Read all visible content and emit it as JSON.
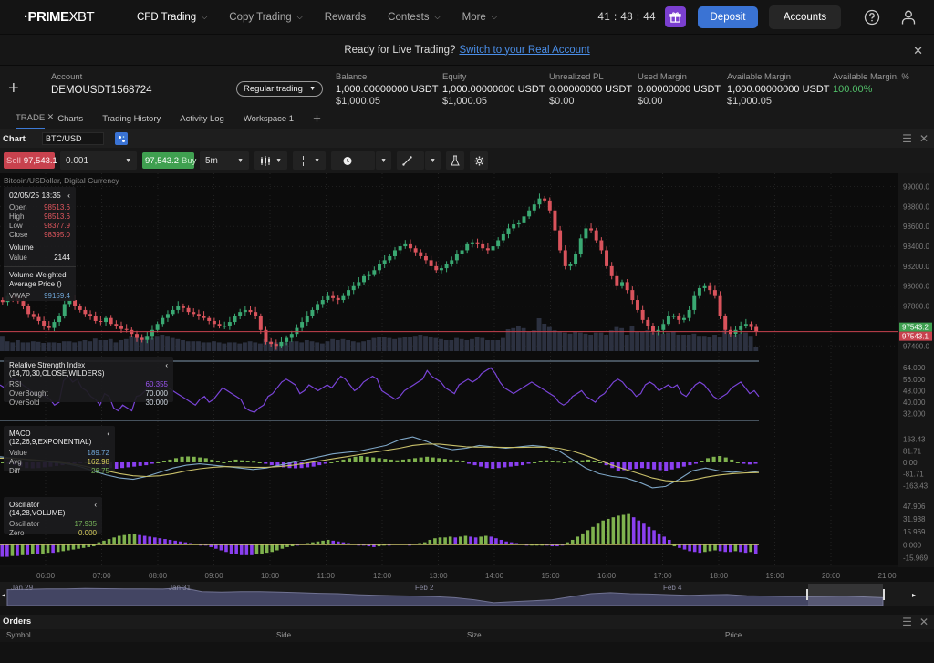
{
  "brand": {
    "name_bold": "·PRIME",
    "name_light": "XBT"
  },
  "topnav": {
    "items": [
      {
        "label": "CFD Trading",
        "has_dropdown": true,
        "active": true
      },
      {
        "label": "Copy Trading",
        "has_dropdown": true,
        "active": false
      },
      {
        "label": "Rewards",
        "has_dropdown": false,
        "active": false
      },
      {
        "label": "Contests",
        "has_dropdown": true,
        "active": false
      },
      {
        "label": "More",
        "has_dropdown": true,
        "active": false
      }
    ],
    "timer": "41 : 48 : 44",
    "gift_icon": "gift-icon",
    "deposit_label": "Deposit",
    "accounts_label": "Accounts",
    "help_icon": "help-circle-icon",
    "user_icon": "user-icon",
    "colors": {
      "deposit": "#3a73d4",
      "gift": "#7b3fd0"
    }
  },
  "banner": {
    "text": "Ready for Live Trading?",
    "link": "Switch to your Real Account",
    "close_icon": "close-icon"
  },
  "account": {
    "add_icon": "plus-icon",
    "account_label": "Account",
    "account_id": "DEMOUSDT1568724",
    "mode": "Regular trading",
    "fields": [
      {
        "label": "Balance",
        "value": "1,000.00000000 USDT",
        "usd": "$1,000.05"
      },
      {
        "label": "Equity",
        "value": "1,000.00000000 USDT",
        "usd": "$1,000.05"
      },
      {
        "label": "Unrealized PL",
        "value": "0.00000000 USDT",
        "usd": "$0.00"
      },
      {
        "label": "Used Margin",
        "value": "0.00000000 USDT",
        "usd": "$0.00"
      },
      {
        "label": "Available Margin",
        "value": "1,000.00000000 USDT",
        "usd": "$1,000.05"
      },
      {
        "label": "Available Margin, %",
        "value": "100.00%",
        "usd": ""
      }
    ]
  },
  "tabs": [
    {
      "label": "TRADE",
      "active": true,
      "closable": true
    },
    {
      "label": "Charts",
      "active": false
    },
    {
      "label": "Trading History",
      "active": false
    },
    {
      "label": "Activity Log",
      "active": false
    },
    {
      "label": "Workspace 1",
      "active": false
    }
  ],
  "chart_panel": {
    "title": "Chart",
    "symbol": "BTC/USD",
    "subtitle": "Bitcoin/USDollar, Digital Currency",
    "toolbar": {
      "sell_label": "Sell",
      "sell_price": "97,543.1",
      "quantity": "0.001",
      "buy_price": "97,543.2",
      "buy_label": "Buy",
      "interval": "5m",
      "chart_type_icon": "candlestick-icon",
      "crosshair_icon": "crosshair-icon",
      "timeline_icon": "clock-icon",
      "draw_icon": "line-draw-icon",
      "studies_icon": "flask-icon",
      "settings_icon": "gear-icon"
    },
    "ohlc_box": {
      "datetime": "02/05/25 13:35",
      "open_label": "Open",
      "open": "98513.6",
      "high_label": "High",
      "high": "98513.6",
      "low_label": "Low",
      "low": "98377.9",
      "close_label": "Close",
      "close": "98395.0",
      "volume_title": "Volume",
      "volume_label": "Value",
      "volume": "2144",
      "vwap_title": "Volume Weighted Average Price ()",
      "vwap_label": "VWAP",
      "vwap": "99159.4"
    },
    "rsi_box": {
      "title": "Relative Strength Index (14,70,30,CLOSE,WILDERS)",
      "rsi_label": "RSI",
      "rsi": "60.355",
      "ob_label": "OverBought",
      "ob": "70.000",
      "os_label": "OverSold",
      "os": "30.000"
    },
    "macd_box": {
      "title": "MACD (12,26,9,EXPONENTIAL)",
      "value_label": "Value",
      "value": "189.72",
      "avg_label": "Avg",
      "avg": "162.98",
      "diff_label": "Diff",
      "diff": "26.75"
    },
    "osc_box": {
      "title": "Oscillator (14,28,VOLUME)",
      "osc_label": "Oscillator",
      "osc": "17.935",
      "zero_label": "Zero",
      "zero": "0.000"
    }
  },
  "chart_data": {
    "type": "candlestick",
    "title": "BTC/USD",
    "interval": "5m",
    "price_axis": {
      "ticks": [
        "99000.0",
        "98800.0",
        "98600.0",
        "98400.0",
        "98200.0",
        "98000.0",
        "97800.0",
        "97400.0"
      ],
      "range": [
        97320,
        99060
      ]
    },
    "last_price": {
      "bid": "97543.1",
      "ask": "97543.2",
      "colors": {
        "bid": "#c8424e",
        "ask": "#3fa050"
      }
    },
    "time_axis": [
      "06:00",
      "07:00",
      "08:00",
      "09:00",
      "10:00",
      "11:00",
      "12:00",
      "13:00",
      "14:00",
      "15:00",
      "16:00",
      "17:00",
      "18:00",
      "19:00",
      "20:00",
      "21:00"
    ],
    "close_series": [
      97840,
      97900,
      97880,
      97850,
      97800,
      97720,
      97690,
      97650,
      97600,
      97580,
      97640,
      97700,
      97820,
      97860,
      97800,
      97760,
      97720,
      97700,
      97650,
      97640,
      97680,
      97620,
      97600,
      97570,
      97560,
      97520,
      97480,
      97460,
      97500,
      97560,
      97620,
      97680,
      97720,
      97760,
      97800,
      97780,
      97740,
      97720,
      97700,
      97680,
      97650,
      97620,
      97600,
      97600,
      97640,
      97700,
      97740,
      97760,
      97740,
      97700,
      97560,
      97440,
      97420,
      97400,
      97440,
      97480,
      97520,
      97580,
      97640,
      97700,
      97760,
      97820,
      97860,
      97900,
      97880,
      97860,
      97900,
      97960,
      98000,
      98040,
      98100,
      98120,
      98160,
      98220,
      98260,
      98300,
      98360,
      98400,
      98420,
      98380,
      98340,
      98300,
      98260,
      98200,
      98160,
      98180,
      98220,
      98260,
      98320,
      98360,
      98420,
      98440,
      98420,
      98380,
      98360,
      98400,
      98460,
      98520,
      98580,
      98620,
      98640,
      98700,
      98760,
      98820,
      98880,
      98860,
      98760,
      98560,
      98360,
      98200,
      98220,
      98320,
      98480,
      98580,
      98560,
      98460,
      98360,
      98200,
      98100,
      98000,
      98040,
      97960,
      97860,
      97760,
      97660,
      97600,
      97540,
      97560,
      97620,
      97700,
      97700,
      97660,
      97680,
      97760,
      97900,
      97980,
      98000,
      97960,
      97900,
      97700,
      97560,
      97520,
      97560,
      97600,
      97620,
      97590,
      97543
    ],
    "volume_relative": [
      0.28,
      0.18,
      0.16,
      0.2,
      0.16,
      0.16,
      0.18,
      0.17,
      0.15,
      0.16,
      0.16,
      0.15,
      0.18,
      0.18,
      0.16,
      0.18,
      0.2,
      0.18,
      0.23,
      0.2,
      0.2,
      0.22,
      0.16,
      0.2,
      0.22,
      0.28,
      0.26,
      0.26,
      0.28,
      0.24,
      0.28,
      0.3,
      0.28,
      0.24,
      0.22,
      0.2,
      0.18,
      0.18,
      0.18,
      0.16,
      0.16,
      0.18,
      0.16,
      0.14,
      0.16,
      0.16,
      0.14,
      0.16,
      0.18,
      0.16,
      0.14,
      0.22,
      0.18,
      0.16,
      0.16,
      0.16,
      0.18,
      0.18,
      0.16,
      0.2,
      0.18,
      0.16,
      0.14,
      0.18,
      0.22,
      0.2,
      0.22,
      0.2,
      0.18,
      0.16,
      0.18,
      0.2,
      0.24,
      0.26,
      0.26,
      0.24,
      0.22,
      0.24,
      0.26,
      0.26,
      0.28,
      0.3,
      0.28,
      0.26,
      0.24,
      0.22,
      0.2,
      0.2,
      0.24,
      0.22,
      0.2,
      0.22,
      0.26,
      0.24,
      0.2,
      0.2,
      0.2,
      0.24,
      0.4,
      0.42,
      0.46,
      0.42,
      0.36,
      0.38,
      0.6,
      0.5,
      0.44,
      0.38,
      0.36,
      0.34,
      0.32,
      0.36,
      0.34,
      0.32,
      0.3,
      0.34,
      0.34,
      0.3,
      0.38,
      0.44,
      0.42,
      0.3,
      0.46,
      0.36,
      0.36,
      0.38,
      0.34,
      0.34,
      0.32,
      0.34,
      0.36,
      0.3,
      0.3,
      0.3,
      0.32,
      0.28,
      0.28,
      0.26,
      0.3,
      0.26,
      0.38,
      0.32,
      0.3,
      0.32,
      0.34,
      0.28,
      0.08
    ],
    "rsi": {
      "range": [
        28,
        66
      ],
      "ticks": [
        "64.000",
        "56.000",
        "48.000",
        "40.000",
        "32.000"
      ],
      "overbought": 70,
      "oversold": 30,
      "values": [
        52,
        50,
        54,
        56,
        55,
        52,
        50,
        47,
        45,
        46,
        44,
        42,
        38,
        40,
        55,
        58,
        54,
        56,
        50,
        48,
        44,
        42,
        38,
        46,
        44,
        36,
        34,
        38,
        36,
        34,
        44,
        45,
        48,
        52,
        54,
        50,
        52,
        50,
        48,
        46,
        44,
        42,
        40,
        38,
        42,
        44,
        40,
        42,
        46,
        50,
        48,
        46,
        44,
        42,
        36,
        34,
        33,
        36,
        38,
        44,
        46,
        50,
        54,
        56,
        54,
        52,
        46,
        48,
        52,
        50,
        48,
        50,
        52,
        50,
        54,
        58,
        56,
        52,
        48,
        50,
        54,
        56,
        58,
        56,
        48,
        46,
        44,
        42,
        44,
        48,
        50,
        52,
        54,
        56,
        62,
        58,
        56,
        54,
        50,
        48,
        46,
        52,
        54,
        56,
        54,
        56,
        60,
        62,
        64,
        60,
        54,
        50,
        48,
        46,
        48,
        50,
        52,
        54,
        52,
        50,
        48,
        46,
        44,
        40,
        38,
        40,
        44,
        46,
        48,
        44,
        42,
        40,
        44,
        46,
        50,
        54,
        56,
        54,
        50,
        48,
        44,
        46,
        52,
        54,
        52,
        48,
        50,
        52,
        50,
        52,
        46,
        44,
        48,
        52,
        54,
        52,
        48,
        44,
        42,
        44,
        46,
        50,
        52,
        54,
        50,
        46,
        48,
        44
      ]
    },
    "macd": {
      "range": [
        -200,
        200
      ],
      "ticks": [
        "163.43",
        "81.71",
        "0.00",
        "-81.71",
        "-163.43"
      ],
      "histogram": [
        0,
        -10,
        -20,
        -30,
        -40,
        -42,
        -40,
        -35,
        -30,
        -25,
        -20,
        -15,
        -10,
        -5,
        0,
        -10,
        -20,
        -30,
        -40,
        -45,
        -40,
        -35,
        -30,
        -25,
        -20,
        -10,
        0,
        10,
        20,
        30,
        40,
        42,
        40,
        35,
        30,
        20,
        10,
        0,
        10,
        20,
        15,
        10,
        5,
        0,
        -10,
        -20,
        -30,
        -35,
        -40,
        -42,
        -40,
        -35,
        -30,
        -20,
        -10,
        0,
        10,
        20,
        30,
        40,
        45,
        40,
        35,
        30,
        25,
        20,
        15,
        20,
        25,
        30,
        35,
        40,
        35,
        30,
        25,
        20,
        15,
        10,
        -10,
        -20,
        -30,
        -40,
        -45,
        -40,
        -35,
        -30,
        -25,
        -20,
        -10,
        0,
        10,
        15,
        10,
        5,
        0,
        5,
        10,
        15,
        20,
        10,
        0,
        -20,
        -40,
        -60,
        -55,
        -50,
        -45,
        -40,
        -45,
        -50,
        -55,
        -60,
        -50,
        -40,
        -30,
        -20,
        -10,
        10,
        30,
        40,
        45,
        35,
        20,
        0,
        -10,
        -15,
        -10
      ],
      "value": [
        40,
        30,
        20,
        10,
        0,
        -10,
        -30,
        -60,
        -90,
        -110,
        -120,
        -100,
        -70,
        -40,
        -20,
        -10,
        -20,
        -30,
        -40,
        -50,
        -40,
        -20,
        0,
        20,
        40,
        60,
        70,
        80,
        100,
        120,
        160,
        180,
        150,
        110,
        90,
        100,
        120,
        110,
        100,
        110,
        120,
        110,
        80,
        20,
        -40,
        -80,
        -100,
        -110,
        -140,
        -180,
        -170,
        -120,
        -60,
        -40,
        -60,
        -70,
        -60,
        -70
      ],
      "signal": [
        30,
        28,
        22,
        15,
        5,
        -5,
        -20,
        -40,
        -60,
        -80,
        -95,
        -100,
        -95,
        -80,
        -60,
        -45,
        -35,
        -30,
        -32,
        -35,
        -35,
        -30,
        -20,
        -5,
        10,
        25,
        40,
        55,
        70,
        85,
        100,
        120,
        130,
        130,
        120,
        110,
        108,
        108,
        106,
        106,
        108,
        108,
        100,
        80,
        50,
        15,
        -20,
        -50,
        -80,
        -110,
        -130,
        -135,
        -125,
        -105,
        -90,
        -80,
        -75,
        -72
      ]
    },
    "oscillator": {
      "range": [
        -20,
        50
      ],
      "ticks": [
        "47.906",
        "31.938",
        "15.969",
        "0.000",
        "-15.969"
      ],
      "values": [
        -15,
        -15,
        -14,
        -14,
        -13,
        -13,
        -12,
        -12,
        -11,
        -10,
        -10,
        -9,
        -8,
        -7,
        -6,
        -5,
        -4,
        -3,
        -2,
        3,
        5,
        7,
        9,
        11,
        12,
        13,
        13,
        12,
        11,
        10,
        9,
        8,
        7,
        6,
        5,
        4,
        3,
        2,
        1,
        0,
        -1,
        -3,
        -5,
        -7,
        -9,
        -11,
        -12,
        -13,
        -13,
        -13,
        -12,
        -11,
        -10,
        -9,
        -7,
        -5,
        -3,
        -2,
        0,
        1,
        2,
        3,
        4,
        5,
        6,
        5,
        4,
        3,
        2,
        1,
        0,
        -1,
        -2,
        -3,
        -2,
        -1,
        0,
        1,
        1,
        1,
        0,
        1,
        2,
        3,
        6,
        8,
        9,
        9,
        10,
        9,
        10,
        11,
        10,
        9,
        10,
        11,
        10,
        8,
        6,
        4,
        3,
        2,
        1,
        0,
        0,
        0,
        0,
        -1,
        -2,
        -2,
        0,
        3,
        6,
        10,
        14,
        18,
        22,
        26,
        30,
        32,
        34,
        36,
        37,
        38,
        34,
        30,
        26,
        22,
        18,
        14,
        10,
        6,
        -2,
        -4,
        -6,
        -8,
        -9,
        -10,
        -9,
        -8,
        -7,
        -8,
        -9,
        -9,
        -8,
        -9,
        -10,
        -9,
        -12
      ]
    },
    "navigator": {
      "labels": [
        "Jan 29",
        "Jan 31",
        "Feb 2",
        "Feb 4"
      ]
    }
  },
  "orders": {
    "title": "Orders",
    "columns": [
      "Symbol",
      "Side",
      "Size",
      "Price"
    ],
    "rows": []
  }
}
